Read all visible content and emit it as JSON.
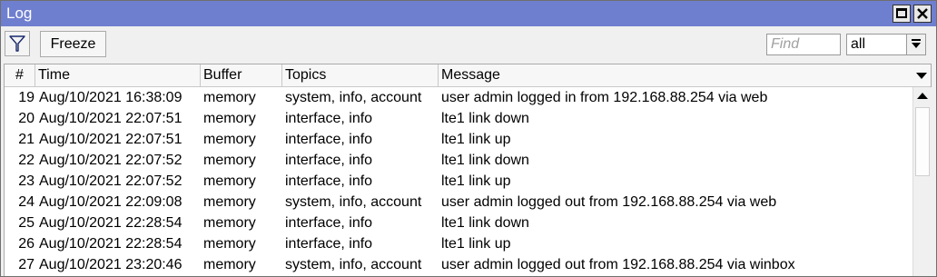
{
  "window": {
    "title": "Log"
  },
  "toolbar": {
    "freeze_label": "Freeze",
    "find_placeholder": "Find",
    "filter_value": "all"
  },
  "table": {
    "columns": [
      "#",
      "Time",
      "Buffer",
      "Topics",
      "Message"
    ],
    "rows": [
      {
        "num": "19",
        "time": "Aug/10/2021 16:38:09",
        "buffer": "memory",
        "topics": "system, info, account",
        "message": "user admin logged in from 192.168.88.254 via web"
      },
      {
        "num": "20",
        "time": "Aug/10/2021 22:07:51",
        "buffer": "memory",
        "topics": "interface, info",
        "message": "lte1 link down"
      },
      {
        "num": "21",
        "time": "Aug/10/2021 22:07:51",
        "buffer": "memory",
        "topics": "interface, info",
        "message": "lte1 link up"
      },
      {
        "num": "22",
        "time": "Aug/10/2021 22:07:52",
        "buffer": "memory",
        "topics": "interface, info",
        "message": "lte1 link down"
      },
      {
        "num": "23",
        "time": "Aug/10/2021 22:07:52",
        "buffer": "memory",
        "topics": "interface, info",
        "message": "lte1 link up"
      },
      {
        "num": "24",
        "time": "Aug/10/2021 22:09:08",
        "buffer": "memory",
        "topics": "system, info, account",
        "message": "user admin logged out from 192.168.88.254 via web"
      },
      {
        "num": "25",
        "time": "Aug/10/2021 22:28:54",
        "buffer": "memory",
        "topics": "interface, info",
        "message": "lte1 link down"
      },
      {
        "num": "26",
        "time": "Aug/10/2021 22:28:54",
        "buffer": "memory",
        "topics": "interface, info",
        "message": "lte1 link up"
      },
      {
        "num": "27",
        "time": "Aug/10/2021 23:20:46",
        "buffer": "memory",
        "topics": "system, info, account",
        "message": "user admin logged out from 192.168.88.254 via winbox"
      }
    ]
  },
  "icons": {
    "filter": "filter-icon",
    "maximize": "maximize-icon",
    "close": "close-icon",
    "dropdown": "dropdown-arrow-icon",
    "column_menu": "chevron-down-icon",
    "scroll_up": "scroll-up-icon"
  },
  "colors": {
    "titlebar": "#6f7fcf"
  }
}
